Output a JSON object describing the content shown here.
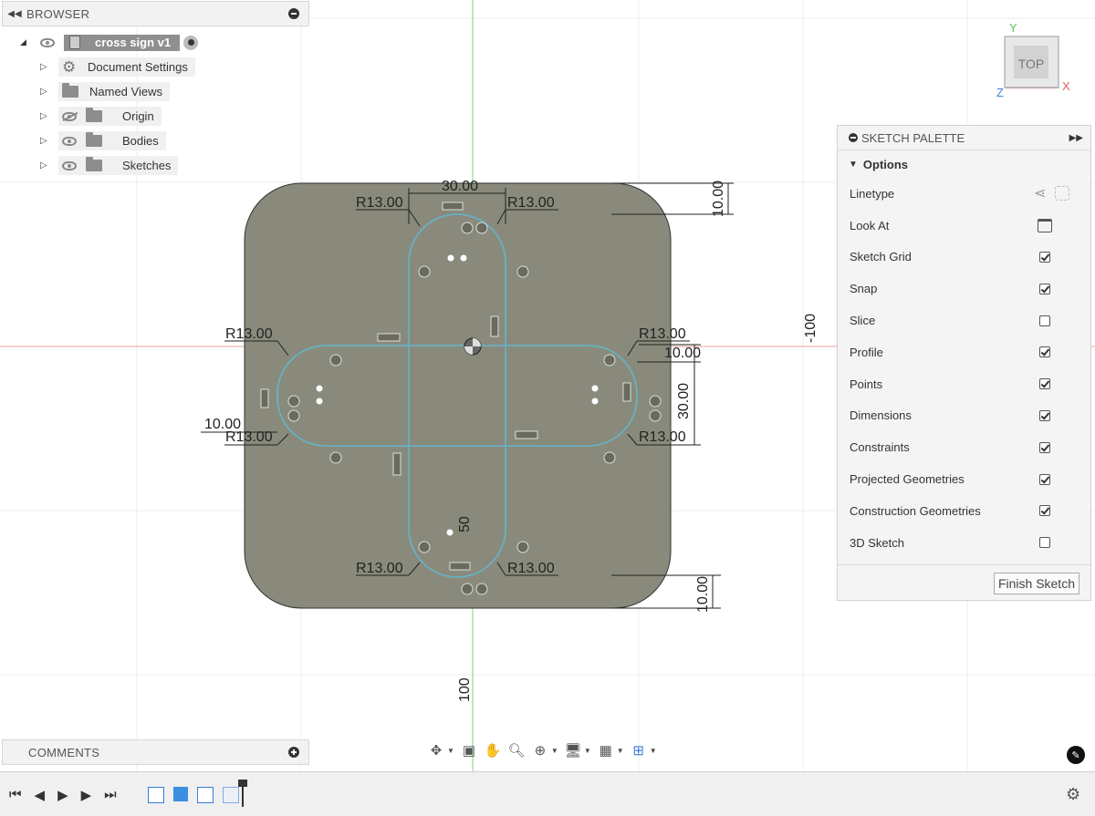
{
  "browser": {
    "title": "BROWSER",
    "root_label": "cross sign v1",
    "items": [
      {
        "label": "Document Settings",
        "icon": "gear-icon"
      },
      {
        "label": "Named Views",
        "icon": "folder-icon"
      },
      {
        "label": "Origin",
        "icon": "folder-icon",
        "visibility": "hidden"
      },
      {
        "label": "Bodies",
        "icon": "folder-icon",
        "visibility": "visible"
      },
      {
        "label": "Sketches",
        "icon": "folder-icon",
        "visibility": "visible"
      }
    ]
  },
  "comments": {
    "title": "COMMENTS"
  },
  "viewcube": {
    "face": "TOP",
    "axis_y": "Y",
    "axis_x": "X",
    "axis_z": "Z"
  },
  "palette": {
    "title": "SKETCH PALETTE",
    "section": "Options",
    "rows": [
      {
        "label": "Linetype",
        "type": "icons"
      },
      {
        "label": "Look At",
        "type": "icon"
      },
      {
        "label": "Sketch Grid",
        "type": "checkbox",
        "checked": true
      },
      {
        "label": "Snap",
        "type": "checkbox",
        "checked": true
      },
      {
        "label": "Slice",
        "type": "checkbox",
        "checked": false
      },
      {
        "label": "Profile",
        "type": "checkbox",
        "checked": true
      },
      {
        "label": "Points",
        "type": "checkbox",
        "checked": true
      },
      {
        "label": "Dimensions",
        "type": "checkbox",
        "checked": true
      },
      {
        "label": "Constraints",
        "type": "checkbox",
        "checked": true
      },
      {
        "label": "Projected Geometries",
        "type": "checkbox",
        "checked": true
      },
      {
        "label": "Construction Geometries",
        "type": "checkbox",
        "checked": true
      },
      {
        "label": "3D Sketch",
        "type": "checkbox",
        "checked": false
      }
    ],
    "finish_label": "Finish Sketch"
  },
  "sketch": {
    "dim_width": "30.00",
    "dim_height": "30.00",
    "dim_top_gap": "10.00",
    "dim_bottom_gap": "10.00",
    "dim_right_gap": "10.00",
    "dim_left_gap": "10.00",
    "radius": "R13.00",
    "center_label": "50",
    "grid_label_right": "-100",
    "grid_label_bottom": "100"
  },
  "colors": {
    "body": "#8a8a7c",
    "profile": "#5fb8d0",
    "x_axis": "#e8a0a0",
    "y_axis": "#7fd08a"
  }
}
